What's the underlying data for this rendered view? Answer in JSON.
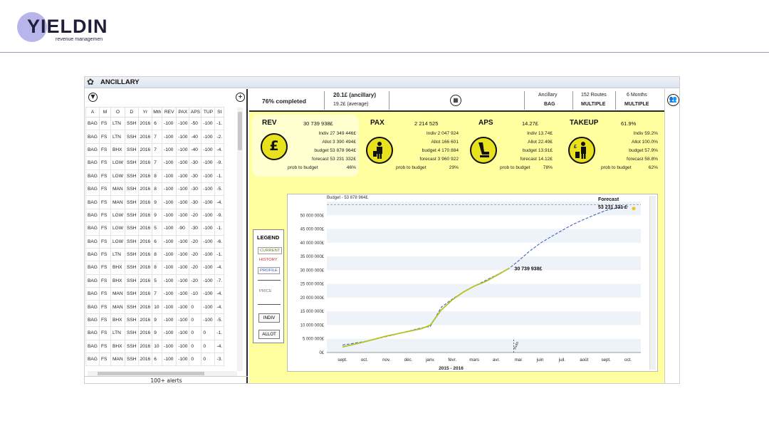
{
  "brand": {
    "name": "YIELDIN",
    "tagline": "revenue managemen"
  },
  "window": {
    "title": "ANCILLARY"
  },
  "table": {
    "headers": [
      "A",
      "M",
      "O",
      "D",
      "Yr",
      "Mth",
      "REV",
      "PAX",
      "APS",
      "TUP",
      "St"
    ],
    "rows": [
      [
        "BAG",
        "FS",
        "LTN",
        "SSH",
        "2016",
        "6",
        "-100",
        "-100",
        "-50",
        "-100",
        "-1."
      ],
      [
        "BAG",
        "FS",
        "LTN",
        "SSH",
        "2016",
        "7",
        "-100",
        "-100",
        "-40",
        "-100",
        "-2."
      ],
      [
        "BAG",
        "FS",
        "BHX",
        "SSH",
        "2016",
        "7",
        "-100",
        "-100",
        "-40",
        "-100",
        "-4."
      ],
      [
        "BAG",
        "FS",
        "LGW",
        "SSH",
        "2016",
        "7",
        "-100",
        "-100",
        "-30",
        "-100",
        "-9."
      ],
      [
        "BAG",
        "FS",
        "LGW",
        "SSH",
        "2016",
        "8",
        "-100",
        "-100",
        "-30",
        "-100",
        "-1."
      ],
      [
        "BAG",
        "FS",
        "MAN",
        "SSH",
        "2016",
        "8",
        "-100",
        "-100",
        "-30",
        "-100",
        "-5."
      ],
      [
        "BAG",
        "FS",
        "MAN",
        "SSH",
        "2016",
        "9",
        "-100",
        "-100",
        "-30",
        "-100",
        "-4."
      ],
      [
        "BAG",
        "FS",
        "LGW",
        "SSH",
        "2016",
        "9",
        "-100",
        "-100",
        "-20",
        "-100",
        "-9."
      ],
      [
        "BAG",
        "FS",
        "LGW",
        "SSH",
        "2016",
        "5",
        "-100",
        "-90",
        "-30",
        "-100",
        "-1."
      ],
      [
        "BAG",
        "FS",
        "LGW",
        "SSH",
        "2016",
        "6",
        "-100",
        "-100",
        "-20",
        "-100",
        "-6."
      ],
      [
        "BAG",
        "FS",
        "LTN",
        "SSH",
        "2016",
        "8",
        "-100",
        "-100",
        "-20",
        "-100",
        "-1."
      ],
      [
        "BAG",
        "FS",
        "BHX",
        "SSH",
        "2016",
        "8",
        "-100",
        "-100",
        "-20",
        "-100",
        "-4."
      ],
      [
        "BAG",
        "FS",
        "BHX",
        "SSH",
        "2016",
        "5",
        "-100",
        "-100",
        "-20",
        "-100",
        "-7."
      ],
      [
        "BAG",
        "FS",
        "MAN",
        "SSH",
        "2016",
        "7",
        "-100",
        "-100",
        "-10",
        "-100",
        "-4."
      ],
      [
        "BAG",
        "FS",
        "MAN",
        "SSH",
        "2016",
        "10",
        "-100",
        "-100",
        "0",
        "-100",
        "-4."
      ],
      [
        "BAG",
        "FS",
        "BHX",
        "SSH",
        "2016",
        "9",
        "-100",
        "-100",
        "0",
        "-100",
        "-5."
      ],
      [
        "BAG",
        "FS",
        "LTN",
        "SSH",
        "2016",
        "9",
        "-100",
        "-100",
        "0",
        "0",
        "-1."
      ],
      [
        "BAG",
        "FS",
        "BHX",
        "SSH",
        "2016",
        "10",
        "-100",
        "-100",
        "0",
        "0",
        "-4."
      ],
      [
        "BAG",
        "FS",
        "MAN",
        "SSH",
        "2016",
        "6",
        "-100",
        "-100",
        "0",
        "0",
        "-3."
      ]
    ],
    "footer": "100+ alerts"
  },
  "statusbar": {
    "completed": "76% completed",
    "ancillary_value": "20.1£ (ancillary)",
    "average_value": "19.2£ (average)",
    "ancillary_label": "Ancillary",
    "ancillary_selected": "BAG",
    "routes_label": "152 Routes",
    "routes_selected": "MULTIPLE",
    "months_label": "6 Months",
    "months_selected": "MULTIPLE"
  },
  "kpis": [
    {
      "name": "REV",
      "total": "30 739 938£",
      "lines": [
        "Indiv  27 349 446£",
        "Allot  3 390 494£",
        "budget  53 878 964£",
        "forecast  53 231 332£"
      ],
      "prob_label": "prob to budget",
      "prob_value": "46%",
      "icon": "pound-coin-icon",
      "glyph": "£"
    },
    {
      "name": "PAX",
      "total": "2 214 525",
      "lines": [
        "Indiv  2 047 924",
        "Allot  166 601",
        "budget  4 170 884",
        "forecast  3 960 922"
      ],
      "prob_label": "prob to budget",
      "prob_value": "29%",
      "icon": "passenger-icon",
      "glyph": ""
    },
    {
      "name": "APS",
      "total": "14.27£",
      "lines": [
        "Indiv  13.74£",
        "Allot  22.49£",
        "budget  13.91£",
        "forecast  14.12£"
      ],
      "prob_label": "prob to budget",
      "prob_value": "78%",
      "icon": "seat-pound-icon",
      "glyph": ""
    },
    {
      "name": "TAKEUP",
      "total": "61.9%",
      "lines": [
        "Indiv  59.2%",
        "Allot  100.0%",
        "budget  57.9%",
        "forecast  58.8%"
      ],
      "prob_label": "prob to budget",
      "prob_value": "62%",
      "icon": "traveller-bag-icon",
      "glyph": ""
    }
  ],
  "legend": {
    "title": "LEGEND",
    "current": "CURRENT",
    "history": "HISTORY",
    "profile": "PROFILE",
    "price": "PRICE",
    "indiv": "INDIV",
    "allot": "ALLOT",
    "colors": {
      "current": "#6a7d1e",
      "history": "#cc3333",
      "profile": "#3355cc"
    }
  },
  "chart_data": {
    "type": "line",
    "budget_label": "Budget - 53 878 964£",
    "budget_value": 53878964,
    "forecast_label": "Forecast",
    "forecast_value_label": "53 231 331 £",
    "current_value_label": "30 739 938£",
    "today_label": "Auto",
    "xlabel": "2015 - 2016",
    "x_ticks": [
      "sept.",
      "oct.",
      "nov.",
      "déc.",
      "janv.",
      "févr.",
      "mars",
      "avr.",
      "mai",
      "juin",
      "juil.",
      "août",
      "sept.",
      "oct."
    ],
    "y_ticks": [
      "0£",
      "5 000 000£",
      "10 000 000£",
      "15 000 000£",
      "20 000 000£",
      "25 000 000£",
      "30 000 000£",
      "35 000 000£",
      "40 000 000£",
      "45 000 000£",
      "50 000 000£"
    ],
    "ylim": [
      0,
      55000000
    ],
    "series": [
      {
        "values": [
          [
            0,
            2700000
          ],
          [
            1,
            4000000
          ],
          [
            2,
            5800000
          ],
          [
            3,
            7800000
          ],
          [
            3.6,
            9000000
          ],
          [
            4,
            9500000
          ],
          [
            4.5,
            16500000
          ],
          [
            5,
            19500000
          ],
          [
            5.5,
            22000000
          ],
          [
            6,
            24200000
          ],
          [
            6.5,
            26200000
          ],
          [
            7,
            28200000
          ],
          [
            7.6,
            30739938
          ],
          [
            8,
            33300000
          ],
          [
            8.5,
            36800000
          ],
          [
            9,
            39800000
          ],
          [
            9.5,
            42200000
          ],
          [
            10,
            44500000
          ],
          [
            10.5,
            46700000
          ],
          [
            11,
            48500000
          ],
          [
            11.5,
            50200000
          ],
          [
            12,
            51800000
          ],
          [
            12.5,
            52700000
          ],
          [
            13,
            53231331
          ]
        ],
        "color": "#4466bb"
      },
      {
        "values": [
          [
            0,
            2000000
          ],
          [
            1,
            3900000
          ],
          [
            2,
            6000000
          ],
          [
            3,
            7700000
          ],
          [
            3.6,
            8700000
          ],
          [
            4,
            10000000
          ],
          [
            4.5,
            15500000
          ],
          [
            5,
            19200000
          ],
          [
            5.5,
            22000000
          ],
          [
            6,
            24200000
          ],
          [
            6.5,
            25800000
          ],
          [
            7,
            28000000
          ],
          [
            7.6,
            30739938
          ]
        ],
        "color": "#b8c222"
      }
    ]
  }
}
